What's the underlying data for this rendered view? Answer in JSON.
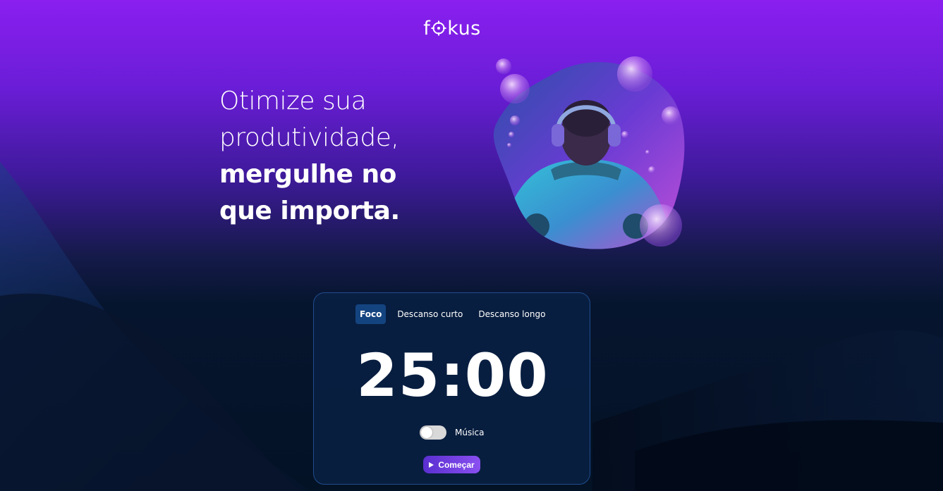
{
  "brand": {
    "logo_left": "f",
    "logo_right": "kus",
    "icon": "target-icon"
  },
  "headline": {
    "line1": "Otimize sua",
    "line2": "produtividade,",
    "line3": "mergulhe no",
    "line4": "que importa."
  },
  "hero": {
    "image": "person-with-headphones-and-bubbles"
  },
  "timer": {
    "tabs": [
      {
        "label": "Foco",
        "active": true
      },
      {
        "label": "Descanso curto",
        "active": false
      },
      {
        "label": "Descanso longo",
        "active": false
      }
    ],
    "time": "25:00",
    "music_label": "Música",
    "music_on": false,
    "start_label": "Começar",
    "start_icon": "play-icon"
  },
  "colors": {
    "background_top": "#8a1ff0",
    "background_bottom": "#041226",
    "active_tab": "#144480",
    "card_border": "#1f4c8c",
    "button_gradient_start": "#5a2fd0",
    "button_gradient_end": "#8a4ff0"
  }
}
